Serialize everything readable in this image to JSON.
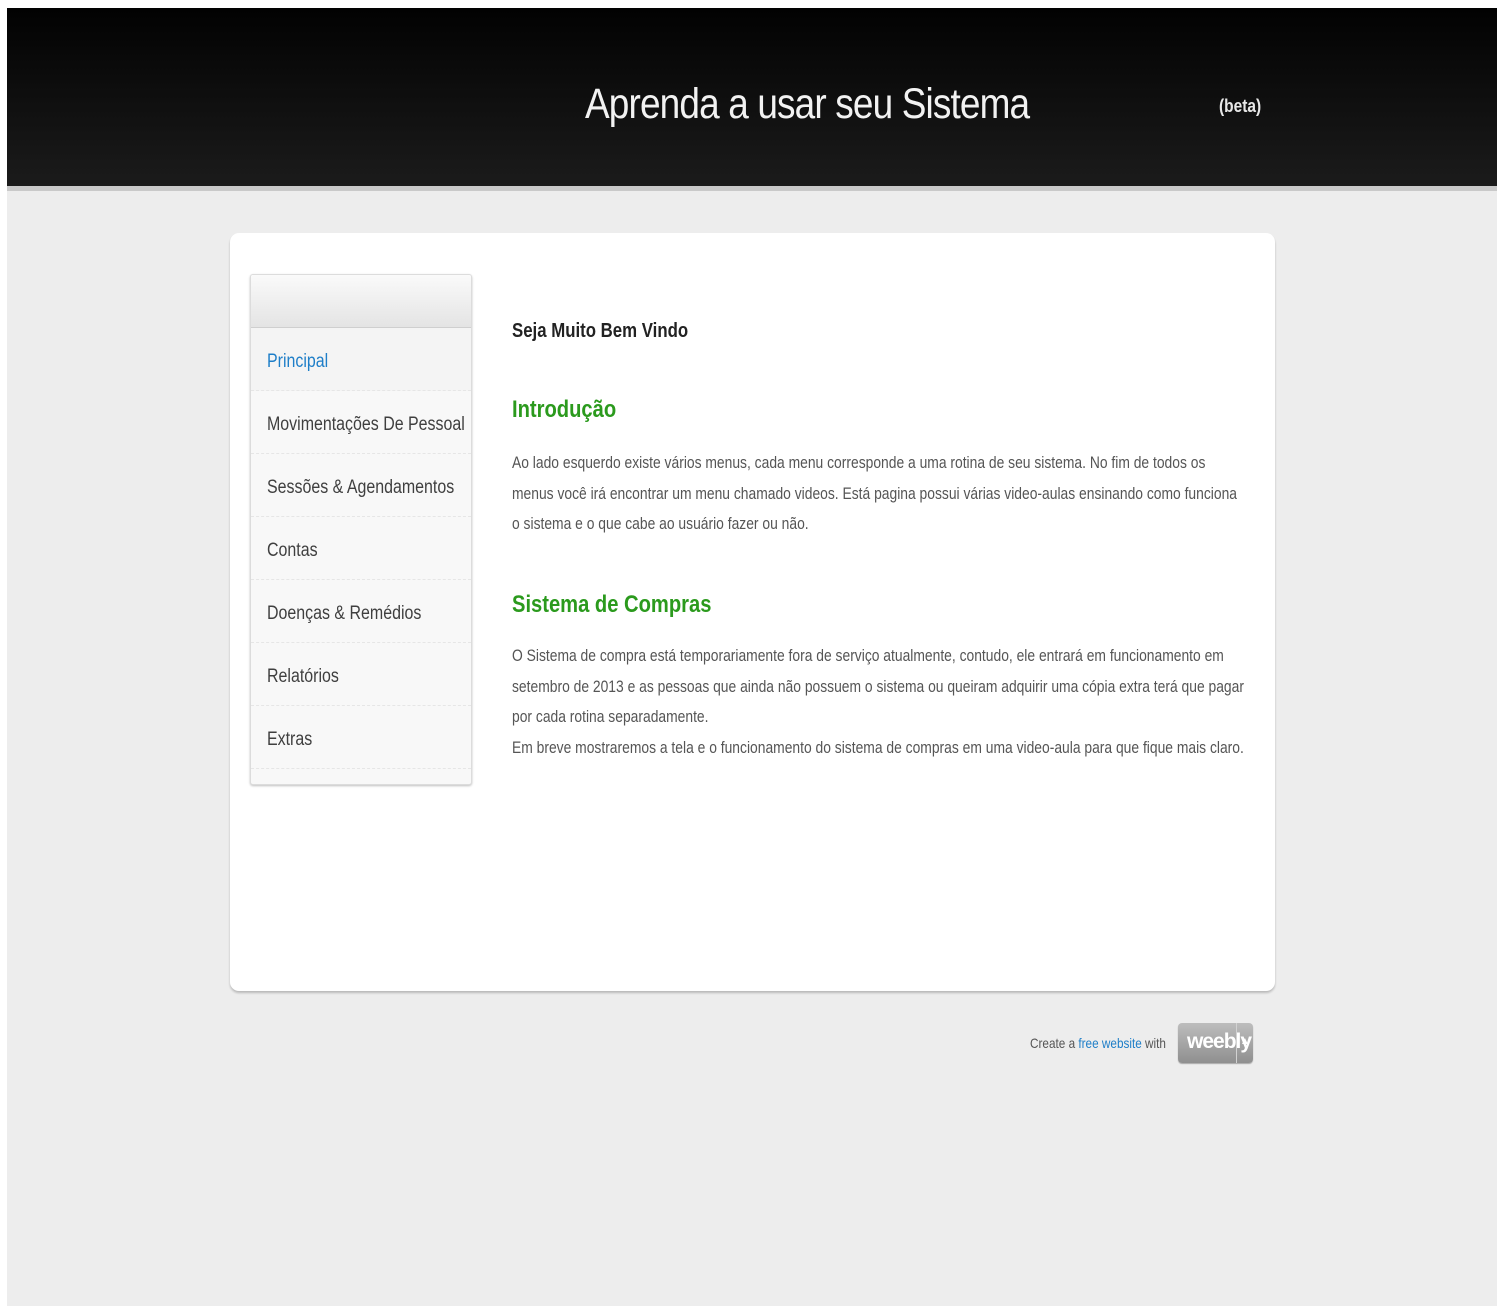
{
  "header": {
    "title": "Aprenda a usar seu Sistema",
    "badge": "(beta)"
  },
  "sidebar": {
    "items": [
      {
        "label": "Principal",
        "active": true
      },
      {
        "label": "Movimentações De Pessoal",
        "active": false
      },
      {
        "label": "Sessões & Agendamentos",
        "active": false
      },
      {
        "label": "Contas",
        "active": false
      },
      {
        "label": "Doenças & Remédios",
        "active": false
      },
      {
        "label": "Relatórios",
        "active": false
      },
      {
        "label": "Extras",
        "active": false
      }
    ]
  },
  "main": {
    "welcome": "Seja Muito Bem Vindo",
    "intro": {
      "title": "Introdução",
      "body": "Ao lado esquerdo existe vários menus, cada menu corresponde a uma rotina de seu sistema. No fim de todos os menus você irá encontrar um menu chamado videos. Está pagina possui várias video-aulas ensinando como funciona o sistema e o que cabe ao usuário fazer ou não."
    },
    "compras": {
      "title": "Sistema de Compras",
      "body1": "O Sistema de compra está temporariamente fora de serviço atualmente, contudo, ele entrará em funcionamento em setembro de 2013 e as pessoas que ainda não possuem o sistema ou queiram adquirir uma cópia extra terá que pagar por cada rotina separadamente.",
      "body2": "Em breve mostraremos a tela e o funcionamento do sistema de compras em uma video-aula para que fique mais claro."
    }
  },
  "footer": {
    "prefix": "Create a",
    "link": "free website",
    "suffix": "with",
    "badge": "weebly",
    "badge_caret": "▲"
  },
  "colors": {
    "header_bg": "#0a0a0a",
    "page_bg": "#ededed",
    "heading_green": "#2b9a1d",
    "link_blue": "#1e7ec8"
  }
}
